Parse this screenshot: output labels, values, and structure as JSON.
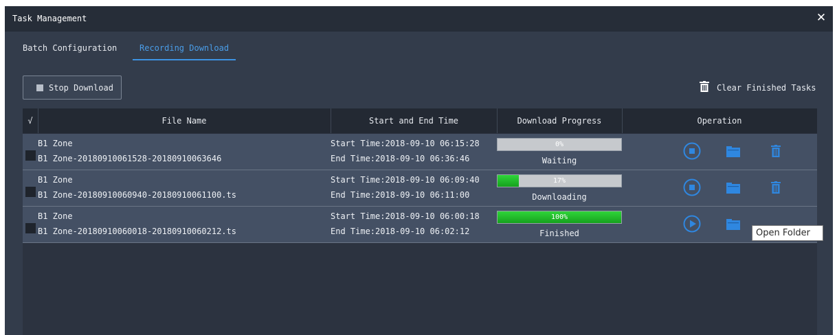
{
  "window": {
    "title": "Task Management",
    "close_glyph": "✕"
  },
  "tabs": [
    {
      "label": "Batch Configuration",
      "active": false
    },
    {
      "label": "Recording Download",
      "active": true
    }
  ],
  "toolbar": {
    "stop_label": "Stop Download",
    "clear_label": "Clear Finished Tasks"
  },
  "table": {
    "select_all_glyph": "√",
    "columns": [
      "File Name",
      "Start and End Time",
      "Download Progress",
      "Operation"
    ],
    "rows": [
      {
        "zone": "B1 Zone",
        "file": "B1 Zone-20180910061528-20180910063646",
        "start": "Start Time:2018-09-10 06:15:28",
        "end": "End Time:2018-09-10 06:36:46",
        "progress": 0,
        "progress_text": "0%",
        "status": "Waiting",
        "action": "stop"
      },
      {
        "zone": "B1 Zone",
        "file": "B1 Zone-20180910060940-20180910061100.ts",
        "start": "Start Time:2018-09-10 06:09:40",
        "end": "End Time:2018-09-10 06:11:00",
        "progress": 17,
        "progress_text": "17%",
        "status": "Downloading",
        "action": "stop"
      },
      {
        "zone": "B1 Zone",
        "file": "B1 Zone-20180910060018-20180910060212.ts",
        "start": "Start Time:2018-09-10 06:00:18",
        "end": "End Time:2018-09-10 06:02:12",
        "progress": 100,
        "progress_text": "100%",
        "status": "Finished",
        "action": "play"
      }
    ]
  },
  "tooltip": {
    "text": "Open Folder"
  },
  "colors": {
    "accent": "#3d93e4",
    "progress": "#22c22c",
    "background": "#333c4b"
  }
}
